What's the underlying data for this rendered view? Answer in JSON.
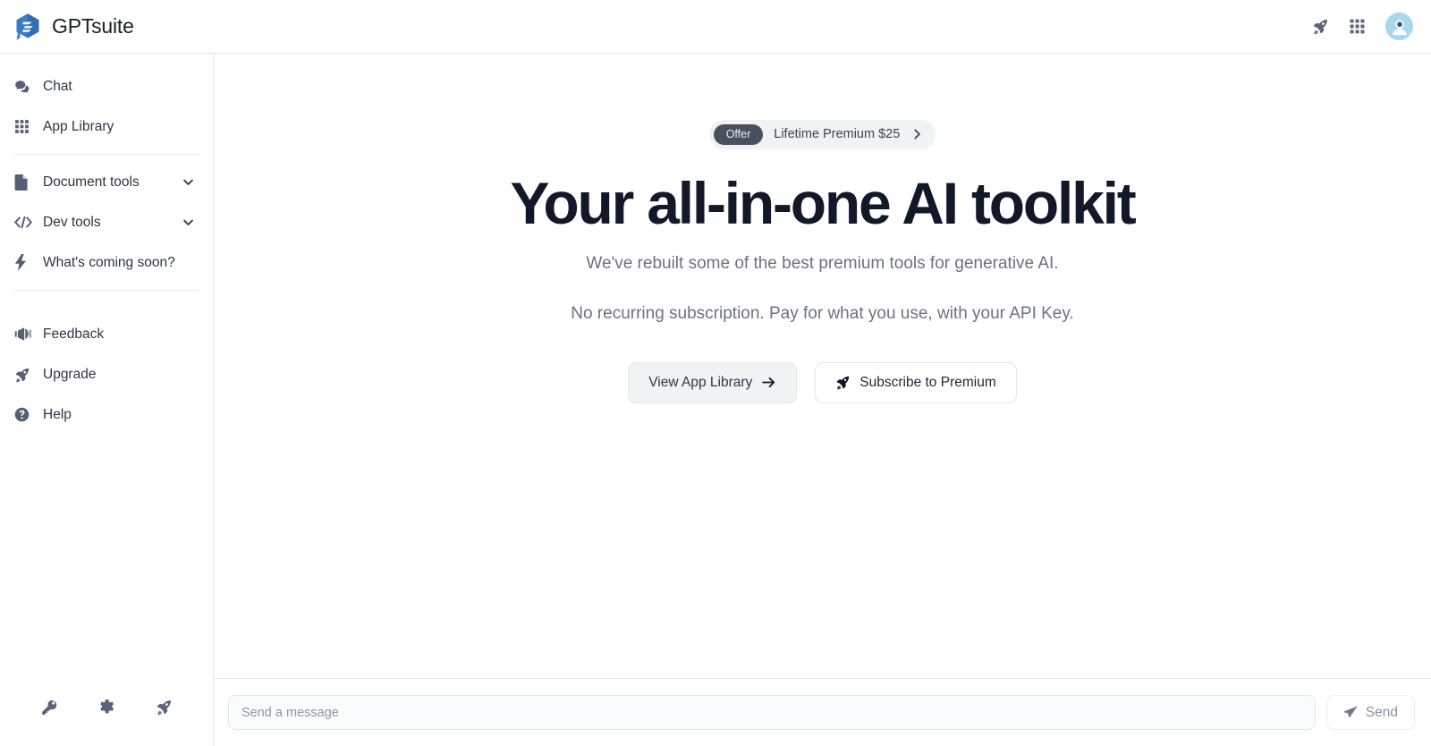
{
  "header": {
    "brand_name": "GPTsuite",
    "logo_icon": "cube-chat-logo",
    "actions": [
      {
        "icon": "rocket-icon",
        "name": "upgrade-rocket-button"
      },
      {
        "icon": "grid-icon",
        "name": "apps-grid-button"
      }
    ],
    "avatar_icon": "user-avatar",
    "avatar_color": "#a8d8f0"
  },
  "sidebar": {
    "groups": [
      {
        "items": [
          {
            "label": "Chat",
            "icon": "chat-bubbles-icon",
            "expandable": false
          },
          {
            "label": "App Library",
            "icon": "grid-icon",
            "expandable": false
          }
        ]
      },
      {
        "items": [
          {
            "label": "Document tools",
            "icon": "document-icon",
            "expandable": true
          },
          {
            "label": "Dev tools",
            "icon": "code-brackets-icon",
            "expandable": true
          },
          {
            "label": "What's coming soon?",
            "icon": "lightning-bolt-icon",
            "expandable": false
          }
        ]
      },
      {
        "items": [
          {
            "label": "Feedback",
            "icon": "megaphone-icon",
            "expandable": false
          },
          {
            "label": "Upgrade",
            "icon": "rocket-icon",
            "expandable": false
          },
          {
            "label": "Help",
            "icon": "question-circle-icon",
            "expandable": false
          }
        ]
      }
    ],
    "footer_icons": [
      {
        "icon": "key-icon",
        "name": "api-key-button"
      },
      {
        "icon": "gear-icon",
        "name": "settings-button"
      },
      {
        "icon": "rocket-icon",
        "name": "upgrade-button"
      }
    ]
  },
  "hero": {
    "offer": {
      "badge": "Offer",
      "text": "Lifetime Premium $25",
      "chevron_icon": "chevron-right-icon",
      "badge_color": "#49515f",
      "pill_color": "#f1f2f4"
    },
    "headline": "Your all-in-one AI toolkit",
    "subtitle": "We've rebuilt some of the best premium tools for generative AI.",
    "subtitle2": "No recurring subscription. Pay for what you use, with your API Key.",
    "buttons": [
      {
        "label": "View App Library",
        "icon": "arrow-right-icon",
        "style": "secondary"
      },
      {
        "label": "Subscribe to Premium",
        "icon": "rocket-icon",
        "style": "outline"
      }
    ]
  },
  "composer": {
    "placeholder": "Send a message",
    "value": "",
    "send_label": "Send",
    "send_icon": "paper-plane-icon"
  }
}
